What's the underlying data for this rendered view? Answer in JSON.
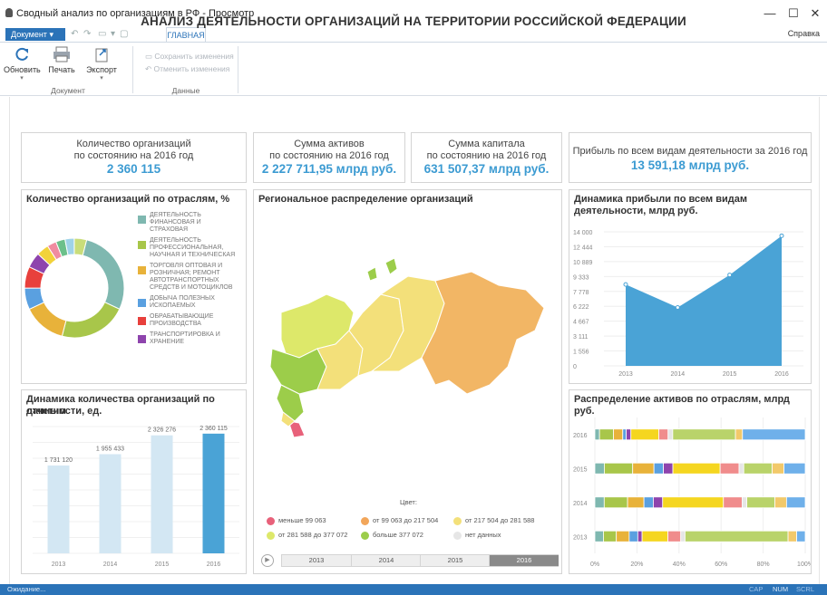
{
  "window": {
    "title": "Сводный анализ по организациям в РФ - Просмотр",
    "controls": {
      "minimize": "—",
      "maximize": "☐",
      "close": "✕"
    }
  },
  "ribbon": {
    "doc_menu": "Документ",
    "tab_home": "ГЛАВНАЯ",
    "help": "Справка",
    "refresh": "Обновить",
    "print": "Печать",
    "export": "Экспорт",
    "group_document": "Документ",
    "save_changes": "Сохранить изменения",
    "cancel_changes": "Отменить изменения",
    "group_data": "Данные"
  },
  "page": {
    "title": "АНАЛИЗ ДЕЯТЕЛЬНОСТИ ОРГАНИЗАЦИЙ НА ТЕРРИТОРИИ РОССИЙСКОЙ ФЕДЕРАЦИИ"
  },
  "kpis": [
    {
      "label1": "Количество организаций",
      "label2": "по состоянию на 2016 год",
      "value": "2 360 115"
    },
    {
      "label1": "Сумма активов",
      "label2": "по состоянию на 2016 год",
      "value": "2 227 711,95 млрд руб."
    },
    {
      "label1": "Сумма капитала",
      "label2": "по состоянию на 2016 год",
      "value": "631 507,37 млрд руб."
    },
    {
      "label1": "Прибыль по всем видам деятельности за 2016 год",
      "label2": "",
      "value": "13 591,18 млрд руб."
    }
  ],
  "panels": {
    "donut_title": "Количество организаций по отраслям, %",
    "map_title": "Региональное распределение организаций",
    "area_title_1": "Динамика прибыли по всем видам",
    "area_title_2": "деятельности, млрд руб.",
    "bar_title_1": "Динамика количества организаций по данным",
    "bar_title_2": "отчетности, ед.",
    "stacked_title": "Распределение активов по отраслям, млрд руб."
  },
  "donut_legend": [
    {
      "lines": [
        "Деятельность",
        "финансовая и",
        "страховая"
      ],
      "color": "#7fb8b0"
    },
    {
      "lines": [
        "Деятельность",
        "профессиональная,",
        "научная и техническая"
      ],
      "color": "#a8c64a"
    },
    {
      "lines": [
        "Торговля оптовая и",
        "розничная; ремонт",
        "автотранспортных",
        "средств и мотоциклов"
      ],
      "color": "#e8b23a"
    },
    {
      "lines": [
        "Добыча полезных",
        "ископаемых"
      ],
      "color": "#5aa0e0"
    },
    {
      "lines": [
        "Обрабатывающие",
        "производства"
      ],
      "color": "#e8403c"
    },
    {
      "lines": [
        "Транспортировка и",
        "хранение"
      ],
      "color": "#8e44ad"
    }
  ],
  "map": {
    "legend_title": "Цвет:",
    "legend": [
      {
        "label": "меньше 99 063",
        "color": "#e8617a"
      },
      {
        "label": "от 99 063 до 217 504",
        "color": "#f2a65a"
      },
      {
        "label": "от 217 504 до 281 588",
        "color": "#f3e07a"
      },
      {
        "label": "от 281 588 до 377 072",
        "color": "#dde86a"
      },
      {
        "label": "больше 377 072",
        "color": "#9ccd4a"
      },
      {
        "label": "нет данных",
        "color": "#e6e6e6"
      }
    ],
    "years": [
      "2013",
      "2014",
      "2015",
      "2016"
    ],
    "selected_year": "2016"
  },
  "chart_data": [
    {
      "type": "pie",
      "title": "Количество организаций по отраслям, %",
      "segments": [
        {
          "name": "Деятельность финансовая и страховая",
          "value": 28,
          "color": "#7fb8b0"
        },
        {
          "name": "Деятельность профессиональная, научная и техническая",
          "value": 22,
          "color": "#a8c64a"
        },
        {
          "name": "Торговля оптовая и розничная; ремонт автотранспортных средств и мотоциклов",
          "value": 14,
          "color": "#e8b23a"
        },
        {
          "name": "Добыча полезных ископаемых",
          "value": 7,
          "color": "#5aa0e0"
        },
        {
          "name": "Обрабатывающие производства",
          "value": 7,
          "color": "#e8403c"
        },
        {
          "name": "Транспортировка и хранение",
          "value": 5,
          "color": "#8e44ad"
        },
        {
          "name": "",
          "value": 4,
          "color": "#f2d23a"
        },
        {
          "name": "",
          "value": 3,
          "color": "#f08ca0"
        },
        {
          "name": "",
          "value": 3,
          "color": "#6cc08a"
        },
        {
          "name": "",
          "value": 3,
          "color": "#9fd3e8"
        },
        {
          "name": "",
          "value": 4,
          "color": "#c9dd7a"
        }
      ]
    },
    {
      "type": "area",
      "title": "Динамика прибыли по всем видам деятельности, млрд руб.",
      "categories": [
        "2013",
        "2014",
        "2015",
        "2016"
      ],
      "values": [
        8500,
        6100,
        9500,
        13591.18
      ],
      "yticks": [
        "0",
        "1 556",
        "3 111",
        "4 667",
        "6 222",
        "7 778",
        "9 333",
        "10 889",
        "12 444",
        "14 000"
      ],
      "ylim": [
        0,
        14000
      ],
      "color": "#4aa3d6"
    },
    {
      "type": "bar",
      "title": "Динамика количества организаций по данным отчетности, ед.",
      "categories": [
        "2013",
        "2014",
        "2015",
        "2016"
      ],
      "values": [
        1731120,
        1955433,
        2326276,
        2360115
      ],
      "labels": [
        "1 731 120",
        "1 955 433",
        "2 326 276",
        "2 360 115"
      ],
      "ylim": [
        0,
        2500000
      ],
      "highlight": "2016"
    },
    {
      "type": "bar",
      "title": "Распределение активов по отраслям, млрд руб.",
      "stacked": true,
      "orientation": "horizontal",
      "categories": [
        "2016",
        "2015",
        "2014",
        "2013"
      ],
      "xticks": [
        "0%",
        "20%",
        "40%",
        "60%",
        "80%",
        "100%"
      ],
      "xlim": [
        0,
        100
      ],
      "series_colors": [
        "#7fb8b0",
        "#a8c64a",
        "#e8b23a",
        "#5aa0e0",
        "#8e44ad",
        "#f5d620",
        "#f08c8c",
        "#e6e6e6",
        "#b9d36a",
        "#f2c96a",
        "#6fb0ea"
      ],
      "rows": [
        [
          2,
          6,
          4,
          1.5,
          2,
          12,
          4,
          2,
          27,
          3,
          27
        ],
        [
          4,
          12,
          9,
          4,
          4,
          20,
          8,
          2,
          12,
          5,
          9
        ],
        [
          4,
          10,
          7,
          4,
          4,
          26,
          8,
          2,
          12,
          5,
          8
        ],
        [
          4,
          6,
          6,
          4,
          2,
          12,
          6,
          2,
          48,
          4,
          4
        ]
      ]
    }
  ],
  "status": {
    "left": "Ожидание...",
    "cap": "CAP",
    "num": "NUM",
    "scrl": "SCRL"
  }
}
